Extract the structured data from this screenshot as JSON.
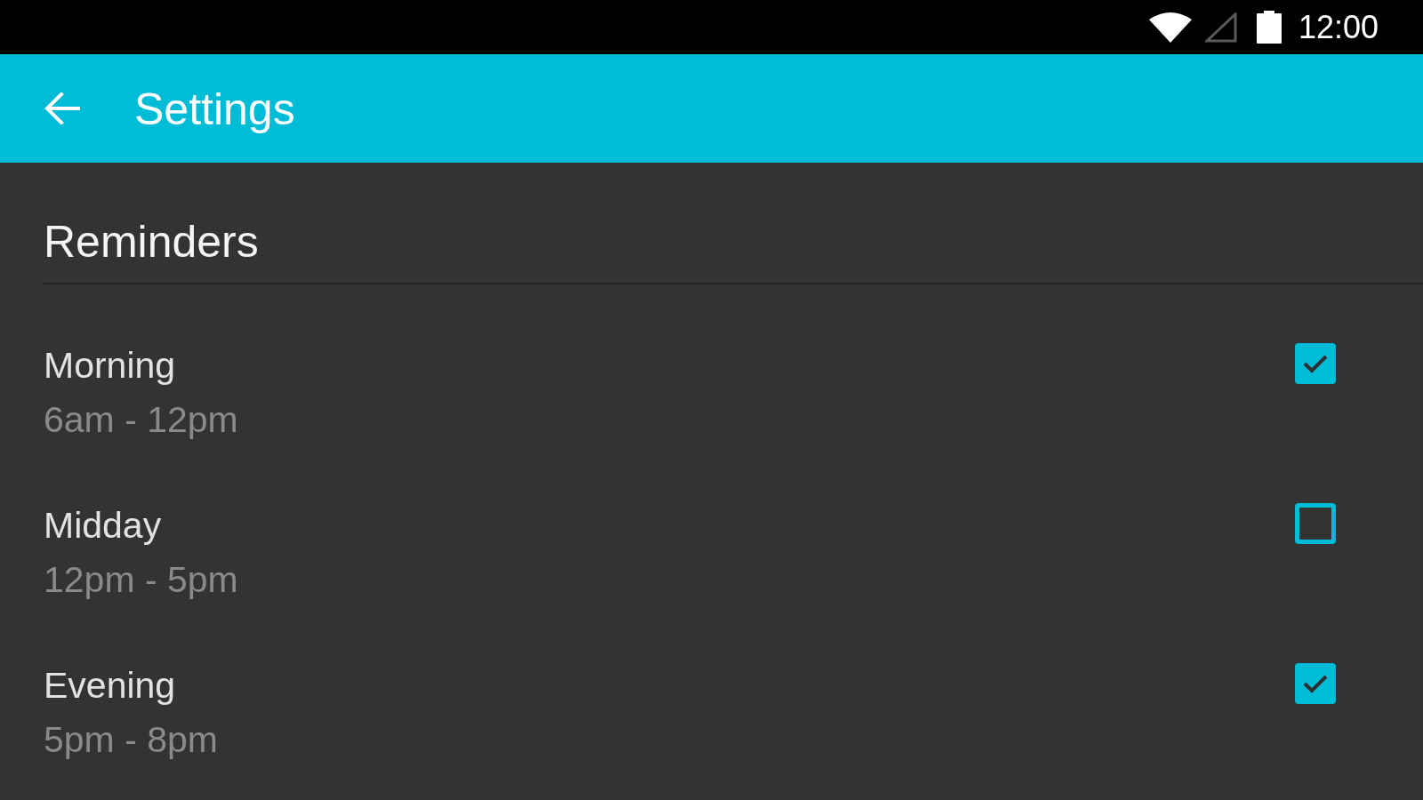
{
  "status_bar": {
    "time": "12:00"
  },
  "app_bar": {
    "title": "Settings"
  },
  "section": {
    "title": "Reminders",
    "items": [
      {
        "title": "Morning",
        "subtitle": "6am - 12pm",
        "checked": true
      },
      {
        "title": "Midday",
        "subtitle": "12pm - 5pm",
        "checked": false
      },
      {
        "title": "Evening",
        "subtitle": "5pm - 8pm",
        "checked": true
      }
    ]
  }
}
